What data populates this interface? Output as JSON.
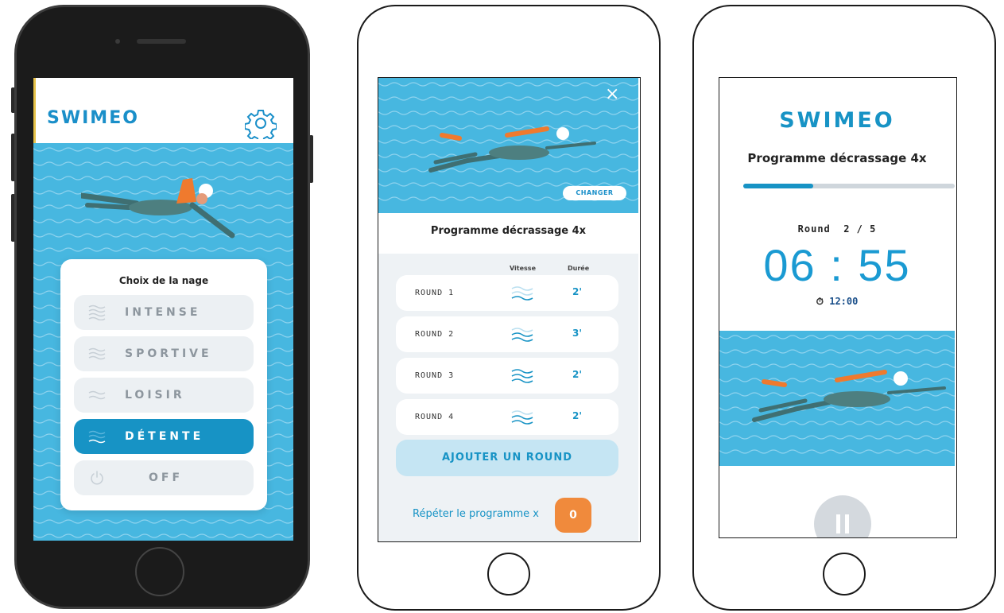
{
  "colors": {
    "brand_blue": "#1793c5",
    "water_blue": "#47b7e0",
    "accent_orange": "#f08a3c",
    "phone_dark": "#1b1b1b"
  },
  "phone1": {
    "logo": "SWIMEO",
    "settings_icon": "gear-icon",
    "card_title": "Choix de la nage",
    "options": [
      {
        "label": "INTENSE",
        "icon": "waves-icon",
        "active": false
      },
      {
        "label": "SPORTIVE",
        "icon": "waves-icon",
        "active": false
      },
      {
        "label": "LOISIR",
        "icon": "waves-icon",
        "active": false
      },
      {
        "label": "DÉTENTE",
        "icon": "waves-icon",
        "active": true
      },
      {
        "label": "OFF",
        "icon": "power-icon",
        "active": false
      }
    ]
  },
  "phone2": {
    "close_icon": "×",
    "changer_label": "CHANGER",
    "title": "Programme décrassage 4x",
    "col_speed": "Vitesse",
    "col_duration": "Durée",
    "rounds": [
      {
        "label": "ROUND 1",
        "duration": "2'"
      },
      {
        "label": "ROUND 2",
        "duration": "3'"
      },
      {
        "label": "ROUND 3",
        "duration": "2'"
      },
      {
        "label": "ROUND 4",
        "duration": "2'"
      }
    ],
    "add_round_label": "AJOUTER UN ROUND",
    "repeat_label": "Répéter le programme x",
    "repeat_count": "0"
  },
  "phone3": {
    "logo": "SWIMEO",
    "title": "Programme décrassage 4x",
    "progress": 0.33,
    "round_label": "Round",
    "round_value": "2 / 5",
    "timer": "06 : 55",
    "total_icon": "⏱",
    "total": "12:00",
    "pause_icon": "pause-icon"
  }
}
